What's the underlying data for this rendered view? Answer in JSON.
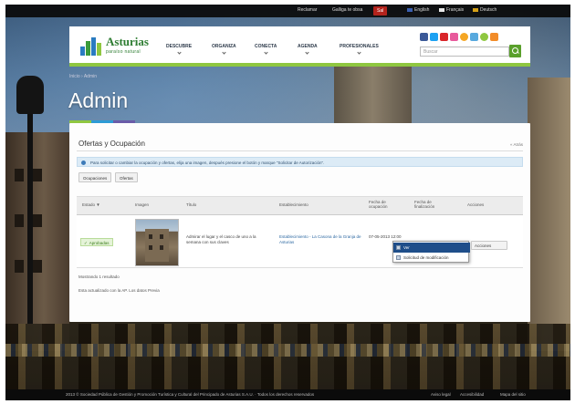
{
  "top_bar": {
    "links": [
      "Reclamar",
      "Galliga te obsa"
    ],
    "button_label": "Sal",
    "languages": [
      "English",
      "Français",
      "Deutsch"
    ]
  },
  "header": {
    "logo_name": "Asturias",
    "logo_tagline": "paraíso natural",
    "nav": [
      "DESCUBRE",
      "ORGANIZA",
      "CONECTA",
      "AGENDA",
      "PROFESIONALES"
    ],
    "search_placeholder": "Buscar",
    "social_icons": [
      "facebook-icon",
      "twitter-icon",
      "youtube-icon",
      "flickr-icon",
      "rss-icon",
      "blog-icon",
      "foursquare-icon",
      "mobile-icon"
    ]
  },
  "breadcrumb": "Inicio › Admin",
  "page_title": "Admin",
  "accent_colors": [
    "#8fc740",
    "#2d9bd5",
    "#6a5ca8"
  ],
  "panel": {
    "title": "Ofertas y Ocupación",
    "back_link": "« Atrás",
    "info_message": "Para solicitar o cambiar la ocupación y ofertas, elija una imagen, después presione el botón y marque \"Solicitar de Autorización\".",
    "tabs": [
      "Ocupaciones",
      "Ofertas"
    ],
    "columns": [
      "Estado ▼",
      "Imagen",
      "Título",
      "Establecimiento",
      "Fecha de ocupación",
      "Fecha de finalización",
      "Acciones"
    ],
    "rows": [
      {
        "status": "Aprobadas",
        "title": "Admirar el lugar y el casco de uno a la semana con sus claves",
        "establishment": "Establecimiento - La Casona de la Granja de Asturias",
        "date_start": "07-05-2013 12:00",
        "action_label": "Acciones"
      }
    ],
    "popup_items": [
      "Ver",
      "Solicitud de modificación"
    ],
    "pagination_text": "Mostrando 1 resultado",
    "footnote": "Esta actualizado con la AP. Los datos Previa"
  },
  "footer": {
    "left_text": "2013 © Sociedad Pública de Gestión y Promoción Turística y Cultural del Principado de Asturias S.A.U. · Todos los derechos reservados",
    "right_links": [
      "Aviso legal",
      "Accesibilidad",
      "Mapa del sitio"
    ]
  }
}
